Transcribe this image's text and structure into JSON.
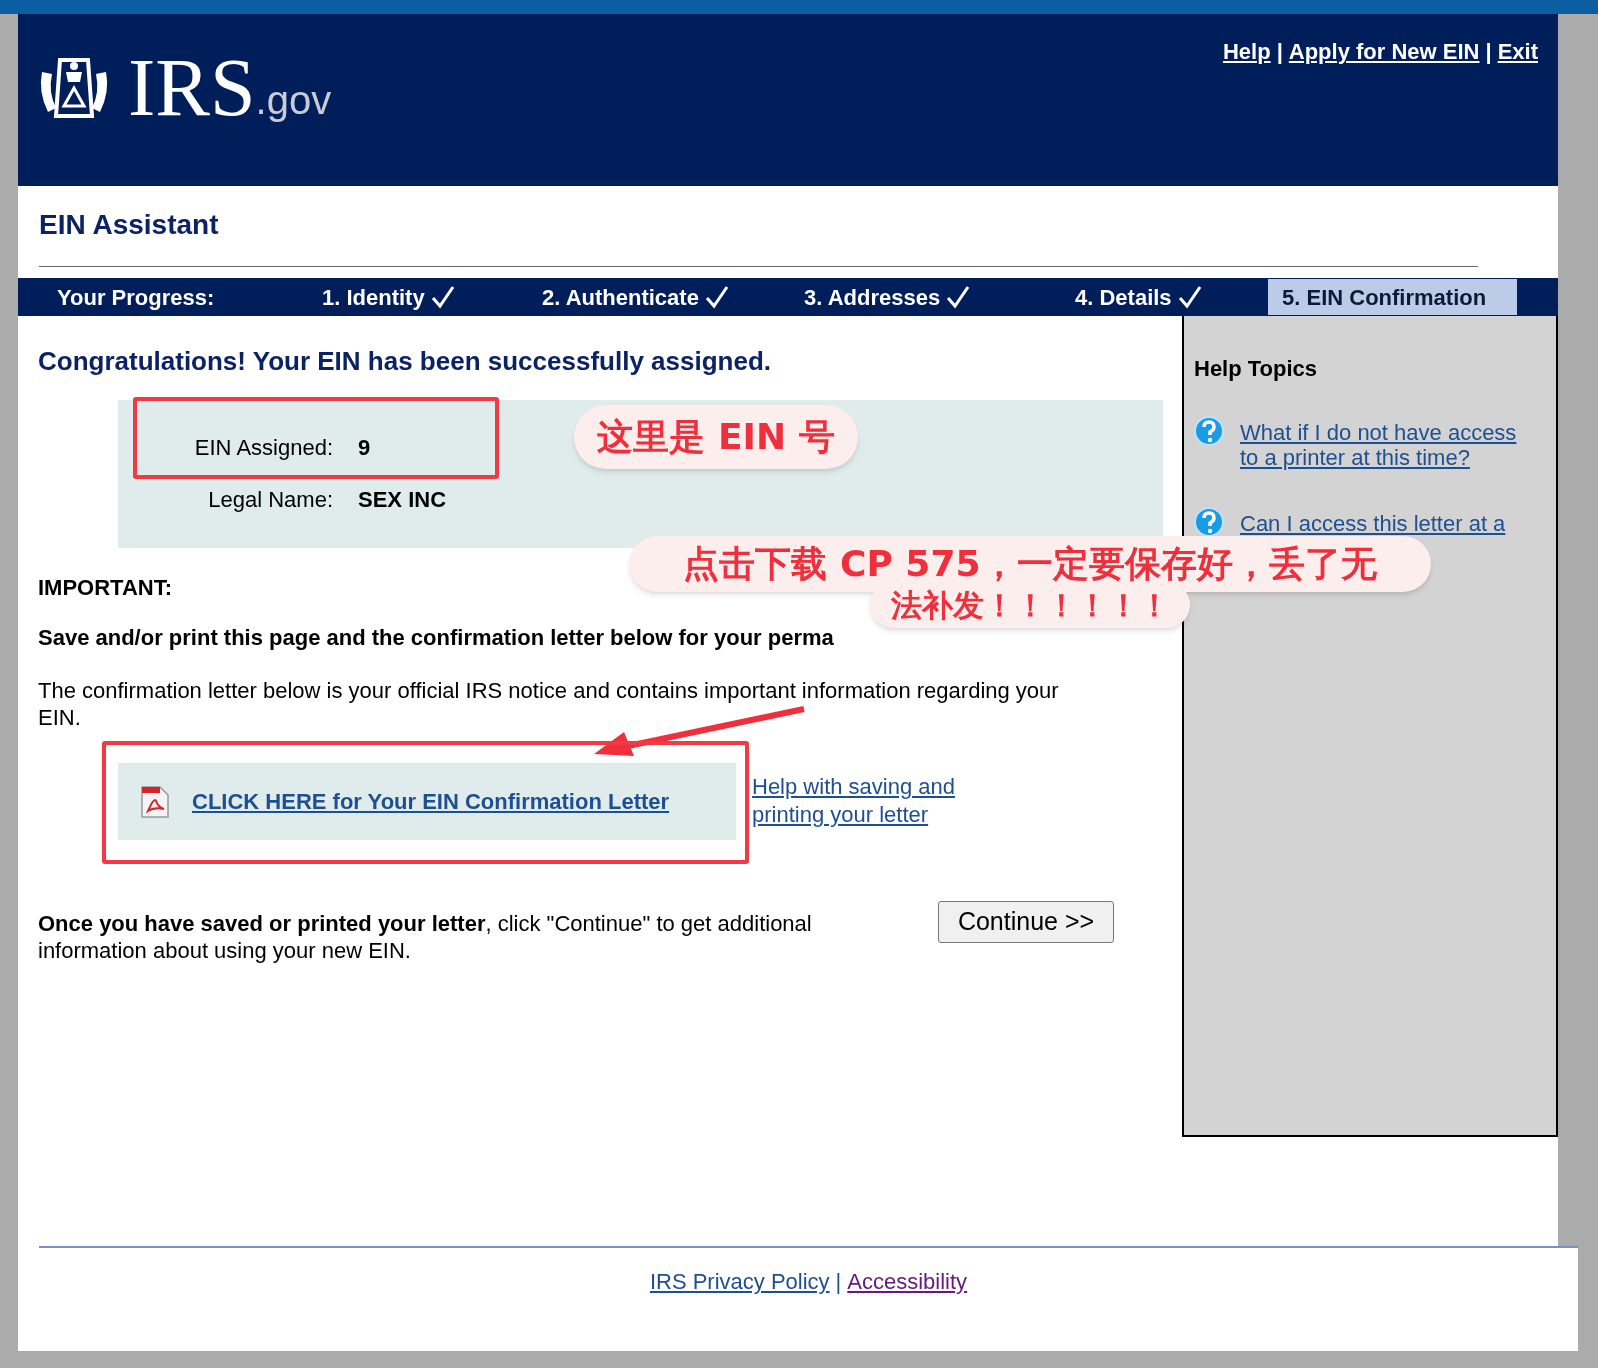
{
  "header": {
    "logo": {
      "mark": "IRS",
      "suffix": ".gov"
    },
    "links": [
      {
        "label": "Help"
      },
      {
        "label": "Apply for New EIN"
      },
      {
        "label": "Exit"
      }
    ],
    "separator": "|"
  },
  "title": "EIN Assistant",
  "progress": {
    "label": "Your Progress:",
    "steps": [
      {
        "label": "1. Identity",
        "done": true,
        "selected": false
      },
      {
        "label": "2. Authenticate",
        "done": true,
        "selected": false
      },
      {
        "label": "3. Addresses",
        "done": true,
        "selected": false
      },
      {
        "label": "4. Details",
        "done": true,
        "selected": false
      },
      {
        "label": "5. EIN Confirmation",
        "done": false,
        "selected": true
      }
    ]
  },
  "heading": "Congratulations! Your EIN has been successfully assigned.",
  "details": [
    {
      "label": "EIN Assigned:",
      "value": "9"
    },
    {
      "label": "Legal Name:",
      "value": "SEX INC"
    }
  ],
  "important": "IMPORTANT:",
  "save_note": "Save and/or print this page and the confirmation letter below for your perma",
  "letter_note": "The confirmation letter below is your official IRS notice and contains important information regarding your EIN.",
  "letter_link": "CLICK HERE for Your EIN Confirmation Letter",
  "help_link": "Help with saving and printing your letter",
  "continue_note": "**Once you have saved or printed your letter**, click \"Continue\" to get additional information about using your new EIN.",
  "continue_button": "Continue >>",
  "sidebar": {
    "title": "Help Topics",
    "items": [
      {
        "label": "What if I do not have access to a printer at this time?"
      },
      {
        "label": "Can I access this letter at a"
      }
    ]
  },
  "footer": {
    "links": [
      {
        "label": "IRS Privacy Policy",
        "visited": false
      },
      {
        "label": "Accessibility",
        "visited": true
      }
    ],
    "separator": "|"
  },
  "annotations": [
    {
      "kind": "box"
    },
    {
      "kind": "bubble",
      "text": "这里是 EIN 号"
    },
    {
      "kind": "bubble",
      "text": "点击下载 CP 575，一定要保存好，丢了无"
    },
    {
      "kind": "bubble",
      "text": "法补发！！！！！！"
    },
    {
      "kind": "arrow"
    },
    {
      "kind": "box"
    }
  ]
}
